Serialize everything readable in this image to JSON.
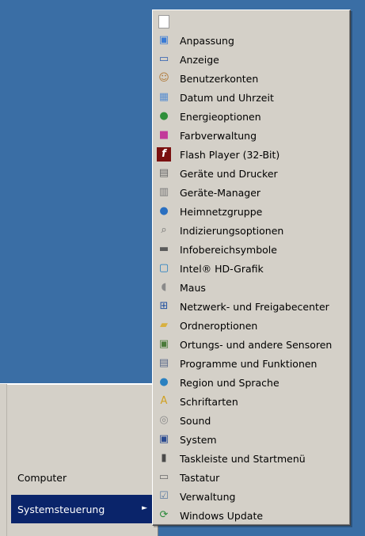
{
  "start_menu": {
    "items": [
      {
        "label": "Computer"
      },
      {
        "label": "Systemsteuerung",
        "arrow": "►"
      }
    ]
  },
  "control_panel_flyout": {
    "items": [
      {
        "label": "",
        "icon": "blank-document-icon",
        "glyph": "",
        "color": "#ffffff"
      },
      {
        "label": "Anpassung",
        "icon": "personalization-icon",
        "glyph": "▣",
        "color": "#3a7bd5"
      },
      {
        "label": "Anzeige",
        "icon": "display-monitor-icon",
        "glyph": "▭",
        "color": "#2a5db0"
      },
      {
        "label": "Benutzerkonten",
        "icon": "user-accounts-icon",
        "glyph": "☺",
        "color": "#b07a3a"
      },
      {
        "label": "Datum und Uhrzeit",
        "icon": "calendar-clock-icon",
        "glyph": "▦",
        "color": "#5a8fd0"
      },
      {
        "label": "Energieoptionen",
        "icon": "battery-power-icon",
        "glyph": "●",
        "color": "#2f8f3a"
      },
      {
        "label": "Farbverwaltung",
        "icon": "color-management-icon",
        "glyph": "■",
        "color": "#c23a9a"
      },
      {
        "label": "Flash Player (32-Bit)",
        "icon": "flash-player-icon",
        "glyph": "f",
        "color": "#7a1010"
      },
      {
        "label": "Geräte und Drucker",
        "icon": "printer-icon",
        "glyph": "▤",
        "color": "#6a6a6a"
      },
      {
        "label": "Geräte-Manager",
        "icon": "device-manager-icon",
        "glyph": "▥",
        "color": "#7a7a7a"
      },
      {
        "label": "Heimnetzgruppe",
        "icon": "homegroup-icon",
        "glyph": "●",
        "color": "#2a6fc0"
      },
      {
        "label": "Indizierungsoptionen",
        "icon": "indexing-magnifier-icon",
        "glyph": "⌕",
        "color": "#6a6a6a"
      },
      {
        "label": "Infobereichsymbole",
        "icon": "notification-area-icon",
        "glyph": "▬",
        "color": "#5a5a5a"
      },
      {
        "label": "Intel® HD-Grafik",
        "icon": "intel-graphics-icon",
        "glyph": "▢",
        "color": "#1a7ac0"
      },
      {
        "label": "Maus",
        "icon": "mouse-icon",
        "glyph": "◖",
        "color": "#8a8a8a"
      },
      {
        "label": "Netzwerk- und Freigabecenter",
        "icon": "network-sharing-icon",
        "glyph": "⊞",
        "color": "#2050a0"
      },
      {
        "label": "Ordneroptionen",
        "icon": "folder-options-icon",
        "glyph": "▰",
        "color": "#d8b040"
      },
      {
        "label": "Ortungs- und andere Sensoren",
        "icon": "location-sensors-icon",
        "glyph": "▣",
        "color": "#4a7a3a"
      },
      {
        "label": "Programme und Funktionen",
        "icon": "programs-features-icon",
        "glyph": "▤",
        "color": "#5a6a8a"
      },
      {
        "label": "Region und Sprache",
        "icon": "globe-region-icon",
        "glyph": "●",
        "color": "#2a80c0"
      },
      {
        "label": "Schriftarten",
        "icon": "fonts-icon",
        "glyph": "A",
        "color": "#d0a020"
      },
      {
        "label": "Sound",
        "icon": "sound-speaker-icon",
        "glyph": "◎",
        "color": "#8a8a8a"
      },
      {
        "label": "System",
        "icon": "system-computer-icon",
        "glyph": "▣",
        "color": "#2a4a90"
      },
      {
        "label": "Taskleiste und Startmenü",
        "icon": "taskbar-startmenu-icon",
        "glyph": "▮",
        "color": "#4a4a4a"
      },
      {
        "label": "Tastatur",
        "icon": "keyboard-icon",
        "glyph": "▭",
        "color": "#6a6a6a"
      },
      {
        "label": "Verwaltung",
        "icon": "administrative-tools-icon",
        "glyph": "☑",
        "color": "#5a7aa0"
      },
      {
        "label": "Windows Update",
        "icon": "windows-update-icon",
        "glyph": "⟳",
        "color": "#2a8a3a"
      }
    ]
  }
}
